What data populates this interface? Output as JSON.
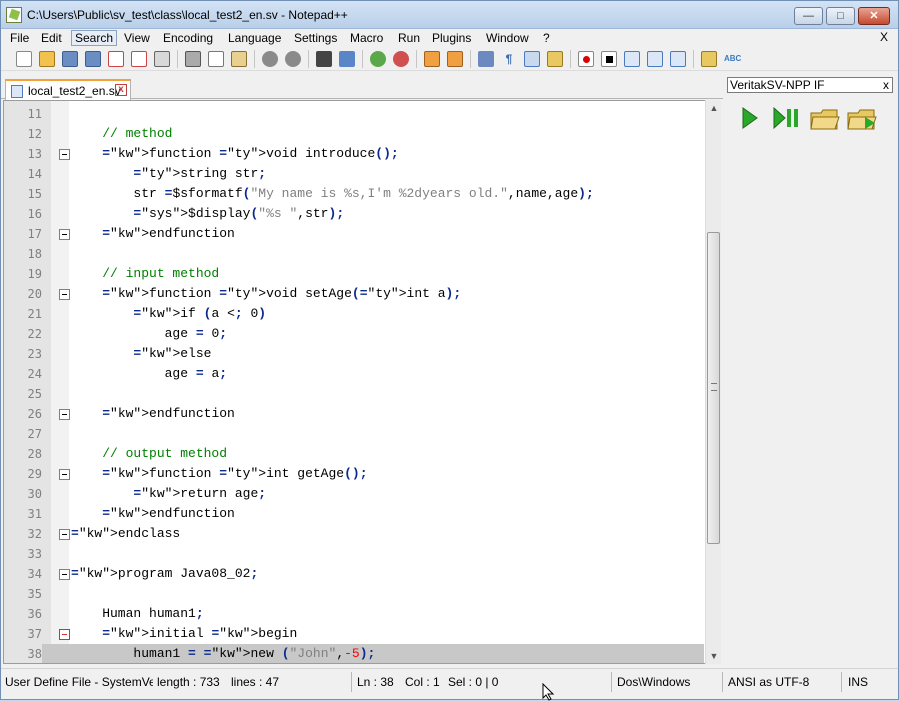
{
  "window": {
    "title": "C:\\Users\\Public\\sv_test\\class\\local_test2_en.sv - Notepad++",
    "minimize": "—",
    "maximize": "□",
    "close": "✕"
  },
  "menu": [
    "File",
    "Edit",
    "Search",
    "View",
    "Encoding",
    "Language",
    "Settings",
    "Macro",
    "Run",
    "Plugins",
    "Window",
    "?"
  ],
  "menu_active": "Search",
  "menu_close": "X",
  "tab": {
    "label": "local_test2_en.sv",
    "close": "x"
  },
  "panel": {
    "title": "VeritakSV-NPP IF",
    "close": "x"
  },
  "editor": {
    "lines": [
      {
        "n": "11",
        "text": ""
      },
      {
        "n": "12",
        "text": "    // method"
      },
      {
        "n": "13",
        "text": "    function void introduce();"
      },
      {
        "n": "14",
        "text": "        string str;"
      },
      {
        "n": "15",
        "text": "        str =$sformatf(\"My name is %s,I'm %2dyears old.\",name,age);"
      },
      {
        "n": "16",
        "text": "        $display(\"%s \",str);"
      },
      {
        "n": "17",
        "text": "    endfunction"
      },
      {
        "n": "18",
        "text": ""
      },
      {
        "n": "19",
        "text": "    // input method"
      },
      {
        "n": "20",
        "text": "    function void setAge(int a);"
      },
      {
        "n": "21",
        "text": "        if (a < 0)"
      },
      {
        "n": "22",
        "text": "            age = 0;"
      },
      {
        "n": "23",
        "text": "        else"
      },
      {
        "n": "24",
        "text": "            age = a;"
      },
      {
        "n": "25",
        "text": ""
      },
      {
        "n": "26",
        "text": "    endfunction"
      },
      {
        "n": "27",
        "text": ""
      },
      {
        "n": "28",
        "text": "    // output method"
      },
      {
        "n": "29",
        "text": "    function int getAge();"
      },
      {
        "n": "30",
        "text": "        return age;"
      },
      {
        "n": "31",
        "text": "    endfunction"
      },
      {
        "n": "32",
        "text": "endclass"
      },
      {
        "n": "33",
        "text": ""
      },
      {
        "n": "34",
        "text": "program Java08_02;"
      },
      {
        "n": "35",
        "text": ""
      },
      {
        "n": "36",
        "text": "    Human human1;"
      },
      {
        "n": "37",
        "text": "    initial begin"
      },
      {
        "n": "38",
        "text": "        human1 = new (\"John\",-5);"
      }
    ]
  },
  "status": {
    "filetype": "User Define File - SystemVer",
    "length": "length : 733",
    "lines": "lines : 47",
    "ln": "Ln : 38",
    "col": "Col : 1",
    "sel": "Sel : 0 | 0",
    "eol": "Dos\\Windows",
    "encoding": "ANSI as UTF-8",
    "mode": "INS"
  },
  "colors": {
    "keyword": "#0b2a8a",
    "type": "#e2701b",
    "comment": "#008000",
    "current_line": "#c8c8c8"
  }
}
